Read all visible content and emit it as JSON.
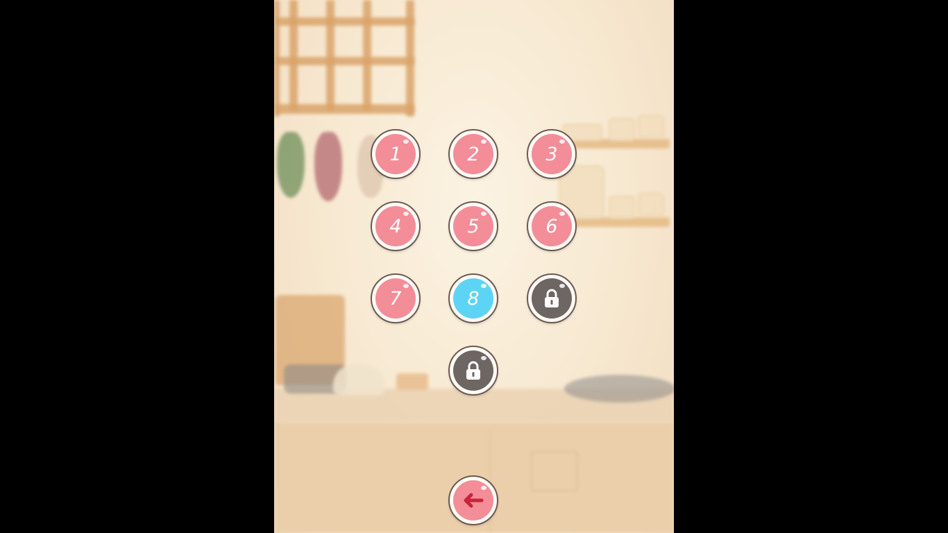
{
  "levels": [
    {
      "label": "1",
      "state": "unlocked",
      "color": "#f38d98"
    },
    {
      "label": "2",
      "state": "unlocked",
      "color": "#f38d98"
    },
    {
      "label": "3",
      "state": "unlocked",
      "color": "#f38d98"
    },
    {
      "label": "4",
      "state": "unlocked",
      "color": "#f38d98"
    },
    {
      "label": "5",
      "state": "unlocked",
      "color": "#f38d98"
    },
    {
      "label": "6",
      "state": "unlocked",
      "color": "#f38d98"
    },
    {
      "label": "7",
      "state": "unlocked",
      "color": "#f38d98"
    },
    {
      "label": "8",
      "state": "current",
      "color": "#5ed4f4"
    },
    {
      "label": "",
      "state": "locked",
      "icon": "lock-icon",
      "color": "#6d6663"
    },
    {
      "label": "",
      "state": "locked",
      "icon": "lock-icon",
      "color": "#6d6663"
    }
  ],
  "back_button": {
    "icon": "arrow-left-icon",
    "color": "#c8243a"
  },
  "theme": {
    "background": "#f8ead3",
    "letterbox": "#000000"
  }
}
